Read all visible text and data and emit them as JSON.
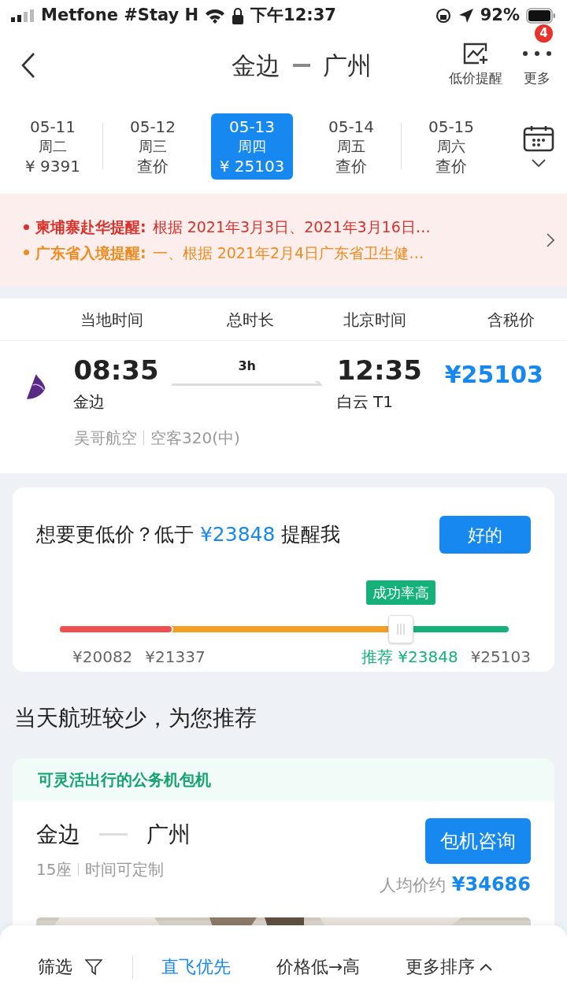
{
  "status_bar": {
    "carrier": "Metfone #Stay H",
    "time": "下午12:37",
    "battery": "92%"
  },
  "header": {
    "from": "金边",
    "to": "广州",
    "actions": [
      {
        "kind": "chart",
        "label": "低价提醒"
      },
      {
        "kind": "more",
        "label": "更多",
        "badge": "4"
      }
    ]
  },
  "dates": [
    {
      "date": "05-11",
      "weekday": "周二",
      "price": "¥ 9391",
      "selected": false
    },
    {
      "date": "05-12",
      "weekday": "周三",
      "price": "查价",
      "selected": false
    },
    {
      "date": "05-13",
      "weekday": "周四",
      "price": "¥ 25103",
      "selected": true
    },
    {
      "date": "05-14",
      "weekday": "周五",
      "price": "查价",
      "selected": false
    },
    {
      "date": "05-15",
      "weekday": "周六",
      "price": "查价",
      "selected": false
    }
  ],
  "notices": [
    {
      "title": "柬埔寨赴华提醒:",
      "text": "根据 2021年3月3日、2021年3月16日…",
      "color": "#d9302a"
    },
    {
      "title": "广东省入境提醒:",
      "text": "一、根据 2021年2月4日广东省卫生健…",
      "color": "#f08a1c"
    }
  ],
  "columns": [
    "当地时间",
    "总时长",
    "北京时间",
    "含税价"
  ],
  "flight": {
    "dep_time": "08:35",
    "dep_airport": "金边",
    "duration": "3h",
    "arr_time": "12:35",
    "arr_airport": "白云 T1",
    "price": "¥25103",
    "airline": "吴哥航空",
    "aircraft": "空客320(中)"
  },
  "price_alert": {
    "text": "想要更低价？低于 **¥23848** 提醒我",
    "button": "好的",
    "tooltip": "成功率高",
    "labels": [
      "¥20082",
      "¥21337",
      "推荐 ¥23848",
      "¥25103"
    ]
  },
  "section_title": "当天航班较少，为您推荐",
  "charter": {
    "tag": "可灵活出行的公务机包机",
    "from": "金边",
    "to": "广州",
    "seats": "15座",
    "note": "时间可定制",
    "button": "包机咨询",
    "price_label": "人均价约",
    "price": "¥34686"
  },
  "bottom_bar": {
    "filter": "筛选",
    "sorts": [
      {
        "label": "直飞优先",
        "selected": true
      },
      {
        "label": "价格低→高",
        "selected": false
      },
      {
        "label": "更多排序",
        "selected": false
      }
    ]
  }
}
